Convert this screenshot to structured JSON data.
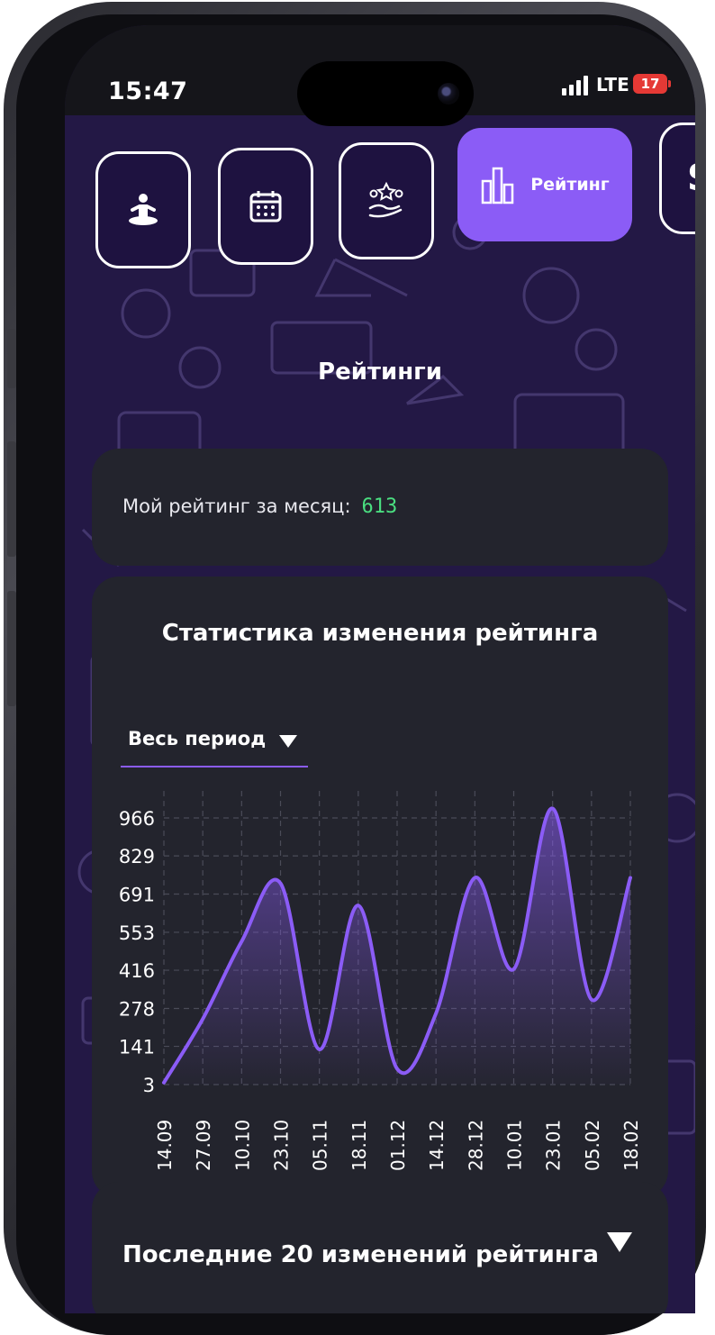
{
  "status_bar": {
    "time": "15:47",
    "network": "LTE",
    "battery": "17"
  },
  "nav": {
    "items": [
      {
        "icon": "person-meditation-icon"
      },
      {
        "icon": "calendar-icon"
      },
      {
        "icon": "stars-hand-icon"
      },
      {
        "icon": "bar-chart-icon",
        "label": "Рейтинг",
        "active": true
      },
      {
        "icon": "partial-item-icon",
        "label": "S"
      }
    ]
  },
  "page": {
    "title": "Рейтинги"
  },
  "my_rating": {
    "label": "Мой рейтинг за месяц:",
    "value": "613"
  },
  "stats": {
    "title": "Статистика изменения рейтинга",
    "period": "Весь период"
  },
  "chart_data": {
    "type": "area",
    "x": [
      "14.09",
      "27.09",
      "10.10",
      "23.10",
      "05.11",
      "18.11",
      "01.12",
      "14.12",
      "28.12",
      "10.01",
      "23.01",
      "05.02",
      "18.02"
    ],
    "y": [
      10,
      240,
      520,
      730,
      130,
      650,
      60,
      260,
      750,
      420,
      1000,
      310,
      750
    ],
    "y_ticks": [
      "966",
      "829",
      "691",
      "553",
      "416",
      "278",
      "141",
      "3"
    ],
    "ylim": [
      3,
      966
    ],
    "grid": true,
    "color": "#8b5cf6"
  },
  "last_changes": {
    "title": "Последние 20 изменений рейтинга"
  },
  "colors": {
    "accent": "#8b5cf6",
    "card": "#23242d",
    "background": "#231845",
    "rating_value": "#4ade80"
  }
}
